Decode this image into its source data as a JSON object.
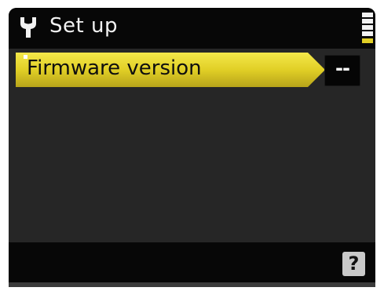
{
  "header": {
    "title": "Set up",
    "icon": "wrench-icon"
  },
  "menu": {
    "items": [
      {
        "label": "Firmware version",
        "value": "--",
        "selected": true
      }
    ]
  },
  "footer": {
    "help_label": "?"
  },
  "colors": {
    "highlight": "#e1cf26",
    "background": "#262626",
    "header": "#070707"
  }
}
